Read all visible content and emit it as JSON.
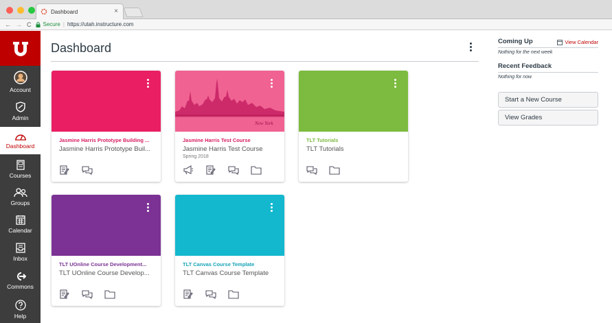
{
  "browser": {
    "tab_title": "Dashboard",
    "secure_label": "Secure",
    "url": "https://utah.instructure.com"
  },
  "global_nav": {
    "items": [
      {
        "label": "Account",
        "icon": "avatar"
      },
      {
        "label": "Admin",
        "icon": "shield-icon"
      },
      {
        "label": "Dashboard",
        "icon": "dashboard-icon",
        "active": true
      },
      {
        "label": "Courses",
        "icon": "courses-icon"
      },
      {
        "label": "Groups",
        "icon": "groups-icon"
      },
      {
        "label": "Calendar",
        "icon": "calendar-icon"
      },
      {
        "label": "Inbox",
        "icon": "inbox-icon"
      },
      {
        "label": "Commons",
        "icon": "commons-icon"
      },
      {
        "label": "Help",
        "icon": "help-icon"
      }
    ]
  },
  "page": {
    "title": "Dashboard"
  },
  "cards": [
    {
      "title": "Jasmine Harris Prototype Building ...",
      "subtitle": "Jasmine Harris Prototype Buil...",
      "term": "",
      "color": "#e91e63",
      "title_color": "#d81b60",
      "icons": [
        "assignments-icon",
        "discussions-icon"
      ]
    },
    {
      "title": "Jasmine Harris Test Course",
      "subtitle": "Jasmine Harris Test Course",
      "term": "Spring 2018",
      "color": "#f06292",
      "title_color": "#d81b60",
      "hero_caption": "New York",
      "icons": [
        "announcements-icon",
        "assignments-icon",
        "discussions-icon",
        "files-icon"
      ]
    },
    {
      "title": "TLT Tutorials",
      "subtitle": "TLT Tutorials",
      "term": "",
      "color": "#7cbb3f",
      "title_color": "#7cbb3f",
      "icons": [
        "discussions-icon",
        "files-icon"
      ]
    },
    {
      "title": "TLT UOnline Course Development...",
      "subtitle": "TLT UOnline Course Develop...",
      "term": "",
      "color": "#7b3294",
      "title_color": "#7b3294",
      "icons": [
        "assignments-icon",
        "discussions-icon",
        "files-icon"
      ]
    },
    {
      "title": "TLT Canvas Course Template",
      "subtitle": "TLT Canvas Course Template",
      "term": "",
      "color": "#14b8ce",
      "title_color": "#14a3b8",
      "icons": [
        "assignments-icon",
        "discussions-icon",
        "files-icon"
      ]
    }
  ],
  "sidebar": {
    "coming_up": "Coming Up",
    "view_calendar": "View Calendar",
    "coming_up_note": "Nothing for the next week",
    "recent_feedback": "Recent Feedback",
    "recent_feedback_note": "Nothing for now",
    "start_course": "Start a New Course",
    "view_grades": "View Grades"
  }
}
